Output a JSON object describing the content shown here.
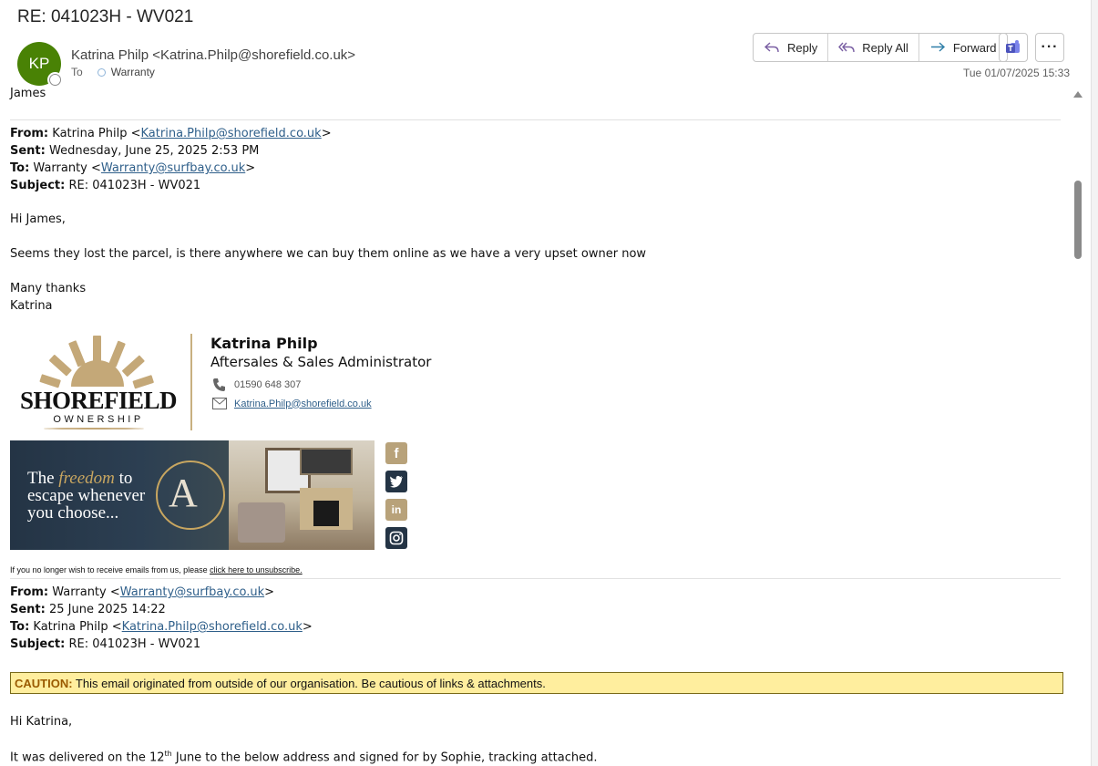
{
  "header": {
    "subject": "RE: 041023H - WV021",
    "avatar_initials": "KP",
    "sender": "Katrina Philp <Katrina.Philp@shorefield.co.uk>",
    "to_label": "To",
    "to_name": "Warranty",
    "date": "Tue 01/07/2025 15:33"
  },
  "actions": {
    "reply": "Reply",
    "reply_all": "Reply All",
    "forward": "Forward",
    "more": "···"
  },
  "body": {
    "greeting": "James",
    "fwd1": {
      "from_label": "From:",
      "from_name": "Katrina Philp <",
      "from_email": "Katrina.Philp@shorefield.co.uk",
      "from_close": ">",
      "sent_label": "Sent:",
      "sent": "Wednesday, June 25, 2025 2:53 PM",
      "to_label": "To:",
      "to_name": "Warranty <",
      "to_email": "Warranty@surfbay.co.uk",
      "to_close": ">",
      "subject_label": "Subject:",
      "subject": "RE: 041023H - WV021"
    },
    "msg1": {
      "greeting": "Hi James,",
      "text": "Seems they lost the parcel, is there anywhere we can buy them online as we have a very upset owner now",
      "closing": "Many thanks",
      "name": "Katrina"
    },
    "signature": {
      "logo_word": "SHOREFIELD",
      "logo_sub": "OWNERSHIP",
      "name": "Katrina Philp",
      "title": "Aftersales & Sales Administrator",
      "phone": "01590 648 307",
      "email": "Katrina.Philp@shorefield.co.uk",
      "banner_line1_a": "The ",
      "banner_line1_b": "freedom",
      "banner_line1_c": " to",
      "banner_line2": "escape whenever",
      "banner_line3": "you choose...",
      "unsub_text": "If you no longer wish to receive emails from us, please ",
      "unsub_link": "click here to unsubscribe."
    },
    "fwd2": {
      "from_label": "From:",
      "from_name": "Warranty <",
      "from_email": "Warranty@surfbay.co.uk",
      "from_close": ">",
      "sent_label": "Sent:",
      "sent": "25 June 2025 14:22",
      "to_label": "To:",
      "to_name": "Katrina Philp <",
      "to_email": "Katrina.Philp@shorefield.co.uk",
      "to_close": ">",
      "subject_label": "Subject:",
      "subject": "RE: 041023H - WV021"
    },
    "caution_label": "CAUTION:",
    "caution_text": " This email originated from outside of our organisation. Be cautious of links & attachments.",
    "msg2": {
      "greeting": "Hi Katrina,",
      "text_a": "It was delivered on the 12",
      "text_sup": "th",
      "text_b": " June to the below address and signed for by Sophie, tracking attached."
    }
  },
  "colors": {
    "avatar": "#498205",
    "link": "#2f5f8a",
    "caution_bg": "#ffee9e",
    "brand_gold": "#c8a660"
  },
  "icons": [
    "reply-icon",
    "reply-all-icon",
    "forward-icon",
    "teams-icon",
    "more-icon",
    "phone-icon",
    "mail-icon",
    "facebook-icon",
    "twitter-icon",
    "linkedin-icon",
    "instagram-icon"
  ]
}
